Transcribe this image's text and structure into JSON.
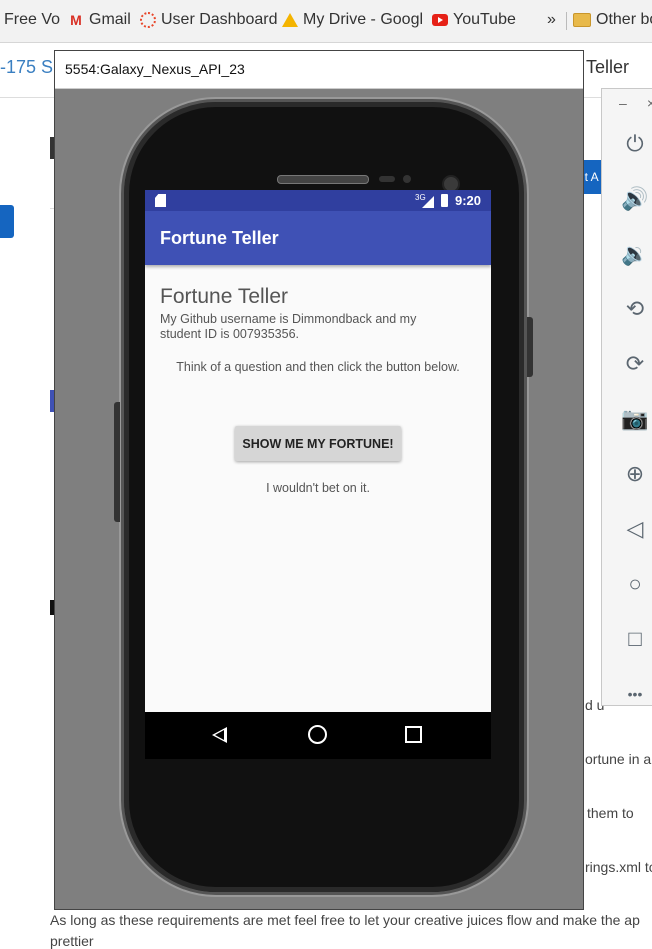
{
  "bookmarks": [
    {
      "label": "Free Vo",
      "icon": "none"
    },
    {
      "label": "Gmail",
      "icon": "gmail-icon"
    },
    {
      "label": "User Dashboard",
      "icon": "dashboard-icon"
    },
    {
      "label": "My Drive - Googl",
      "icon": "drive-icon"
    },
    {
      "label": "YouTube",
      "icon": "youtube-icon"
    },
    {
      "label": "»",
      "icon": "none"
    },
    {
      "label": "Other bo",
      "icon": "folder-icon"
    }
  ],
  "background_page": {
    "course_fragment": "-175 S",
    "title_fragment": "Teller",
    "button_fragment": "it A",
    "para_end_1": "d u",
    "para_end_2": "ortune in a",
    "para_end_3": "them to",
    "para_end_4": "rings.xml to",
    "closing_line_1": "As long as these requirements are met feel free to let your creative juices flow and make the ap",
    "closing_line_2": "prettier"
  },
  "emulator": {
    "window_title": "5554:Galaxy_Nexus_API_23",
    "status_bar": {
      "network": "3G",
      "time": "9:20"
    },
    "app": {
      "toolbar_title": "Fortune Teller",
      "heading": "Fortune Teller",
      "intro": "My Github username is Dimmondback and my student ID is 007935356.",
      "prompt": "Think of a question and then click the button below.",
      "button_label": "SHOW ME MY FORTUNE!",
      "fortune": "I wouldn't bet on it."
    }
  },
  "side_toolbar": {
    "minimize": "–",
    "close": "×",
    "buttons": [
      {
        "name": "power-icon",
        "glyph": "⏻"
      },
      {
        "name": "volume-up-icon",
        "glyph": "🔊"
      },
      {
        "name": "volume-down-icon",
        "glyph": "🔉"
      },
      {
        "name": "rotate-left-icon",
        "glyph": "⟲"
      },
      {
        "name": "rotate-right-icon",
        "glyph": "⟳"
      },
      {
        "name": "camera-icon",
        "glyph": "📷"
      },
      {
        "name": "zoom-icon",
        "glyph": "⊕"
      },
      {
        "name": "back-icon",
        "glyph": "◁"
      },
      {
        "name": "home-icon",
        "glyph": "○"
      },
      {
        "name": "overview-icon",
        "glyph": "□"
      },
      {
        "name": "more-icon",
        "glyph": "•••"
      }
    ]
  }
}
